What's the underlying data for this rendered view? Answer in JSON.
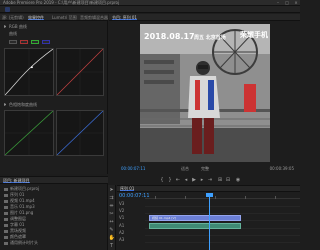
{
  "window": {
    "title": "Adobe Premiere Pro 2019 - C:\\用户\\新建项目\\新建项目.prproj"
  },
  "effect_controls": {
    "tabs": [
      "源: (无剪辑)",
      "效果控件",
      "Lumetri 范围",
      "音频剪辑混合器"
    ],
    "section_label": "RGB 曲线",
    "hsl_label": "色相饱和度曲线",
    "curve_label": "曲线"
  },
  "program_monitor": {
    "tab": "节目: 序列 01",
    "overlay_date": "2018.08.17",
    "overlay_sub": "周五 北京首场",
    "overlay_brand": "荣耀手机",
    "timecode": "00:00:07:11",
    "zoom": "适合",
    "full": "完整",
    "duration": "00:00:39:05"
  },
  "transport": {
    "buttons": [
      "mark-in-icon",
      "mark-out-icon",
      "go-to-in-icon",
      "step-back-icon",
      "play-icon",
      "step-forward-icon",
      "go-to-out-icon",
      "insert-icon",
      "overwrite-icon",
      "export-frame-icon"
    ]
  },
  "project": {
    "tab": "项目: 新建项目",
    "items": [
      "新建项目.prproj",
      "序列 01",
      "视频 01.mp4",
      "音乐 01.mp3",
      "图片 01.png",
      "调整图层",
      "字幕 01",
      "黑场视频",
      "颜色遮罩",
      "通用倒计时片头"
    ]
  },
  "tools": [
    "selection-tool-icon",
    "track-select-icon",
    "ripple-edit-icon",
    "razor-icon",
    "slip-icon",
    "pen-icon",
    "hand-icon",
    "type-icon"
  ],
  "timeline": {
    "tab": "序列 01",
    "timecode": "00:00:07:11",
    "tracks": [
      {
        "name": "V3",
        "kind": "video"
      },
      {
        "name": "V2",
        "kind": "video"
      },
      {
        "name": "V1",
        "kind": "video",
        "clip": "视频 01.mp4 [V]"
      },
      {
        "name": "A1",
        "kind": "audio",
        "clip": ""
      },
      {
        "name": "A2",
        "kind": "audio"
      },
      {
        "name": "A3",
        "kind": "audio"
      }
    ]
  },
  "colors": {
    "accent": "#3ea0ff",
    "video_clip": "#6b7fd6",
    "audio_clip": "#3f8a74"
  }
}
